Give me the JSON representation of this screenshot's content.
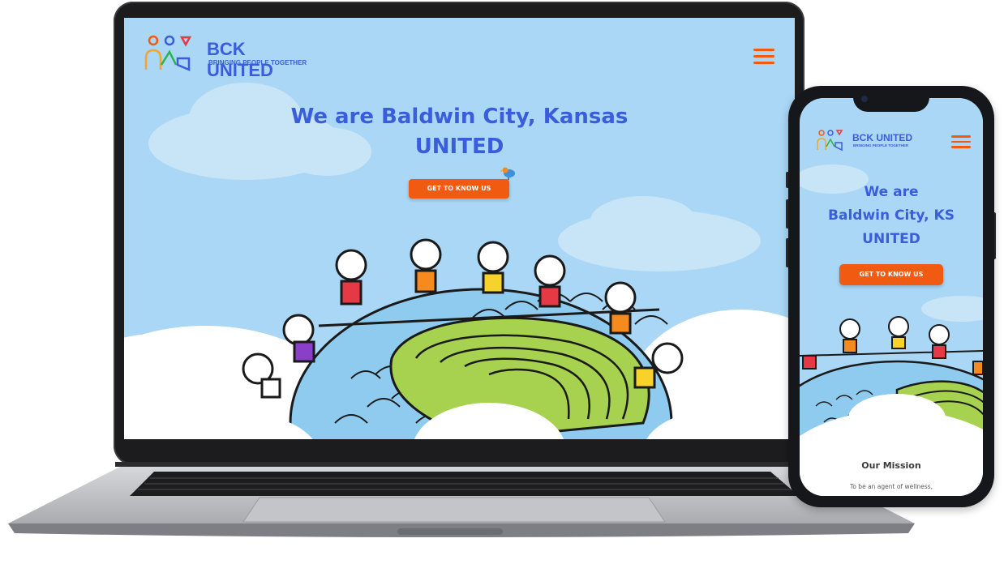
{
  "desktop": {
    "brand": {
      "name": "BCK UNITED",
      "tagline": "BRINGING PEOPLE TOGETHER"
    },
    "hero": {
      "title_line1": "We are Baldwin City, Kansas",
      "title_line2": "UNITED",
      "cta_label": "GET TO KNOW US"
    }
  },
  "mobile": {
    "brand": {
      "name": "BCK UNITED",
      "tagline": "BRINGING PEOPLE TOGETHER"
    },
    "hero": {
      "title_line1": "We are",
      "title_line2": "Baldwin City, KS",
      "title_line3": "UNITED",
      "cta_label": "GET TO KNOW US"
    },
    "mission": {
      "heading": "Our Mission",
      "text": "To be an agent of wellness,"
    }
  },
  "colors": {
    "accent": "#f05a11",
    "brand_blue": "#3a5ddc",
    "sky": "#a9d7f5",
    "hill_green": "#a7d24f",
    "globe_blue": "#8ecbef"
  },
  "icons": [
    "menu-icon",
    "logo-people-icon",
    "bird-icon"
  ]
}
